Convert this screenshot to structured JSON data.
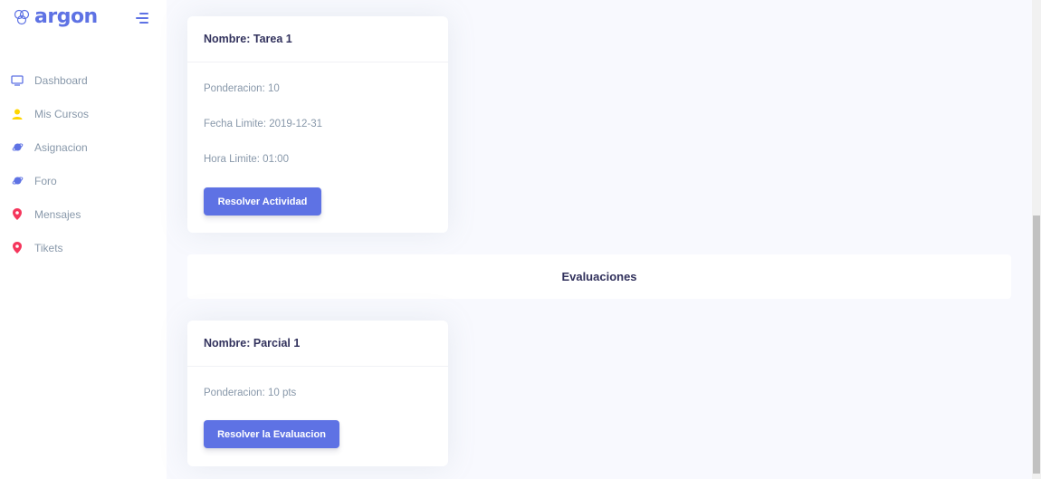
{
  "brand": {
    "name": "argon",
    "color": "#5e72e4"
  },
  "sidebar": {
    "items": [
      {
        "label": "Dashboard",
        "icon": "tv-icon",
        "color": "#5e72e4"
      },
      {
        "label": "Mis Cursos",
        "icon": "user-icon",
        "color": "#ffd600"
      },
      {
        "label": "Asignacion",
        "icon": "planet-icon",
        "color": "#5e72e4"
      },
      {
        "label": "Foro",
        "icon": "planet-icon",
        "color": "#5e72e4"
      },
      {
        "label": "Mensajes",
        "icon": "pin-icon",
        "color": "#f5365c"
      },
      {
        "label": "Tikets",
        "icon": "pin-icon",
        "color": "#f5365c"
      }
    ]
  },
  "task_card": {
    "title": "Nombre: Tarea 1",
    "weighting": "Ponderacion: 10",
    "due_date": "Fecha Limite: 2019-12-31",
    "due_time": "Hora Limite: 01:00",
    "button_label": "Resolver Actividad"
  },
  "evaluations_section": {
    "title": "Evaluaciones"
  },
  "exam_card": {
    "title": "Nombre: Parcial 1",
    "weighting": "Ponderacion: 10 pts",
    "button_label": "Resolver la Evaluacion"
  }
}
